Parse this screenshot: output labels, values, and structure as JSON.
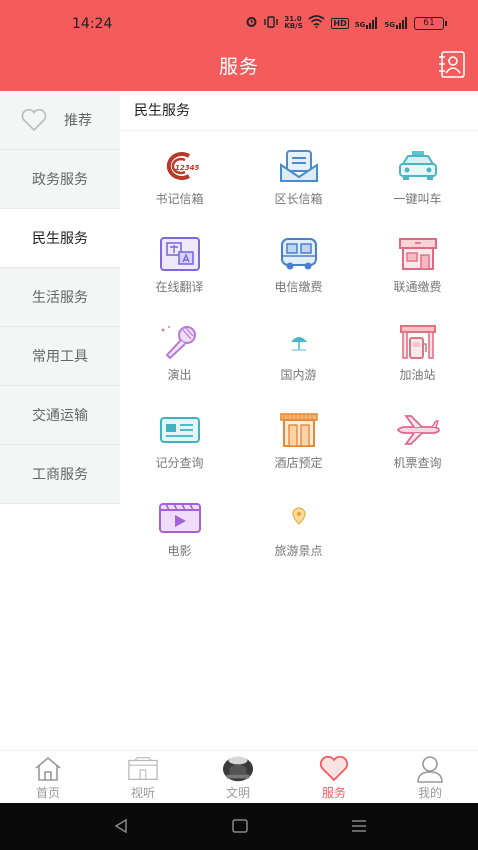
{
  "status_bar": {
    "time": "14:24",
    "net_speed": "31.0 KB/S",
    "hd": "HD",
    "sig1": "5G",
    "sig2": "5G",
    "battery": "61"
  },
  "header": {
    "title": "服务"
  },
  "sidebar": {
    "items": [
      {
        "label": "推荐",
        "icon": "heart-outline-icon"
      },
      {
        "label": "政务服务"
      },
      {
        "label": "民生服务"
      },
      {
        "label": "生活服务"
      },
      {
        "label": "常用工具"
      },
      {
        "label": "交通运输"
      },
      {
        "label": "工商服务"
      }
    ],
    "active_index": 2
  },
  "main": {
    "section_title": "民生服务",
    "services": [
      {
        "label": "书记信箱",
        "icon": "12345-hotline-logo",
        "logo_text": "12345"
      },
      {
        "label": "区长信箱",
        "icon": "mailbox-icon"
      },
      {
        "label": "一键叫车",
        "icon": "taxi-icon"
      },
      {
        "label": "在线翻译",
        "icon": "translate-icon"
      },
      {
        "label": "电信缴费",
        "icon": "bus-icon"
      },
      {
        "label": "联通缴费",
        "icon": "store-icon"
      },
      {
        "label": "演出",
        "icon": "microphone-icon"
      },
      {
        "label": "国内游",
        "icon": "beach-umbrella-icon"
      },
      {
        "label": "加油站",
        "icon": "gas-station-icon"
      },
      {
        "label": "记分查询",
        "icon": "id-card-icon"
      },
      {
        "label": "酒店预定",
        "icon": "hotel-icon"
      },
      {
        "label": "机票查询",
        "icon": "airplane-icon"
      },
      {
        "label": "电影",
        "icon": "movie-icon"
      },
      {
        "label": "旅游景点",
        "icon": "location-pin-icon"
      }
    ]
  },
  "bottom_nav": {
    "items": [
      {
        "label": "首页",
        "icon": "home-icon"
      },
      {
        "label": "视听",
        "icon": "tv-icon"
      },
      {
        "label": "文明",
        "icon": "civilization-photo-icon"
      },
      {
        "label": "服务",
        "icon": "heart-icon"
      },
      {
        "label": "我的",
        "icon": "user-icon"
      }
    ],
    "active_index": 3
  },
  "colors": {
    "brand": "#f45c5c",
    "sidebar_bg": "#f4f5f5",
    "text_muted": "#777777"
  }
}
